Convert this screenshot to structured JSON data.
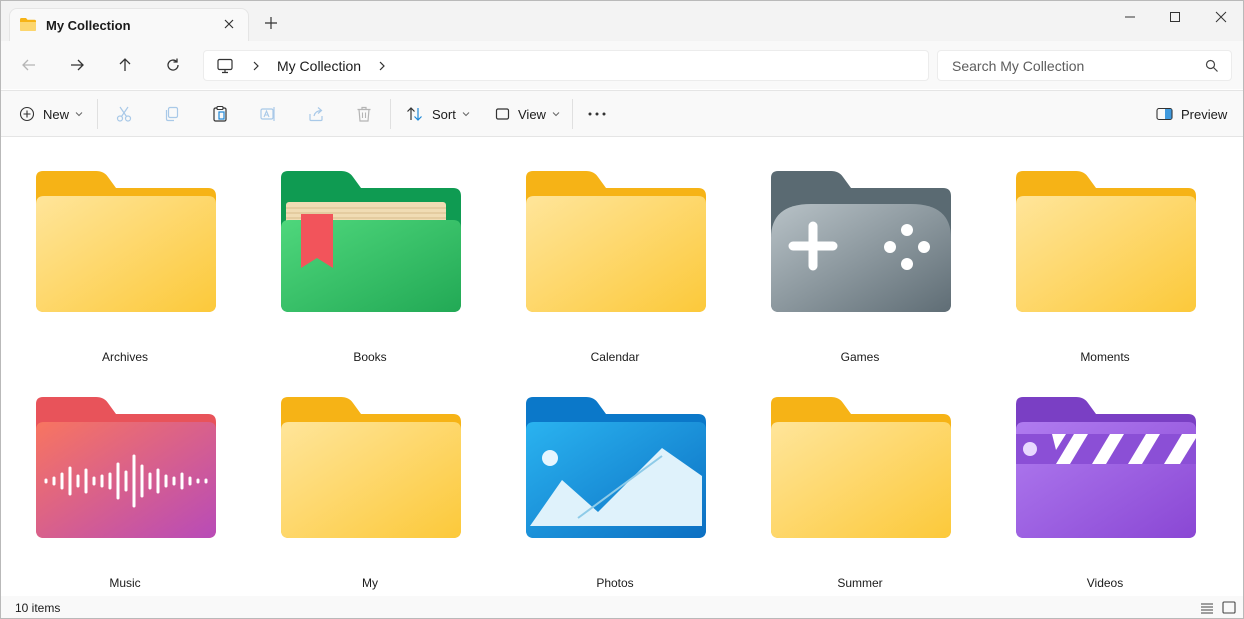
{
  "tab": {
    "title": "My Collection",
    "icon": "folder-icon"
  },
  "window_controls": {
    "minimize": "minimize-icon",
    "maximize": "maximize-icon",
    "close": "close-icon"
  },
  "address_bar": {
    "path": "My Collection"
  },
  "search": {
    "placeholder": "Search My Collection"
  },
  "toolbar": {
    "new_label": "New",
    "sort_label": "Sort",
    "view_label": "View",
    "preview_label": "Preview"
  },
  "folders": [
    {
      "name": "Archives",
      "icon": "yellow-folder-icon"
    },
    {
      "name": "Books",
      "icon": "books-folder-icon"
    },
    {
      "name": "Calendar",
      "icon": "yellow-folder-icon"
    },
    {
      "name": "Games",
      "icon": "games-folder-icon"
    },
    {
      "name": "Moments",
      "icon": "yellow-folder-icon"
    },
    {
      "name": "Music",
      "icon": "music-folder-icon"
    },
    {
      "name": "My",
      "icon": "yellow-folder-icon"
    },
    {
      "name": "Photos",
      "icon": "photos-folder-icon"
    },
    {
      "name": "Summer",
      "icon": "yellow-folder-icon"
    },
    {
      "name": "Videos",
      "icon": "videos-folder-icon"
    }
  ],
  "status": {
    "item_count": "10 items"
  },
  "colors": {
    "folder_yellow": "#fcd66e",
    "folder_tab_yellow": "#f6b316",
    "books_green": "#3fbf6a",
    "games_gray": "#7d8a92",
    "music_pink": "#ef6f78",
    "photos_blue": "#1e90db",
    "videos_purple": "#9b5ddc"
  }
}
